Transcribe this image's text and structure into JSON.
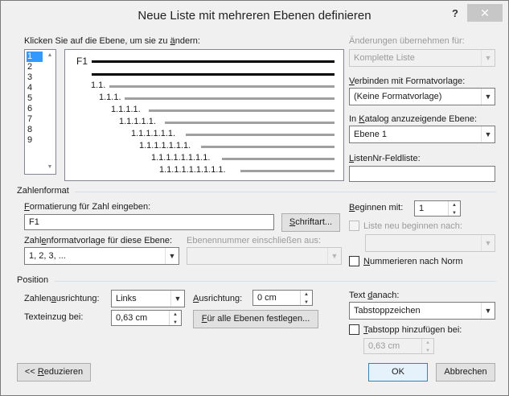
{
  "window": {
    "title": "Neue Liste mit mehreren Ebenen definieren",
    "help": "?",
    "close": "✕"
  },
  "level_select": {
    "label_pre": "Klicken Sie auf die Ebene, um sie zu ",
    "label_u": "ä",
    "label_post": "ndern:",
    "items": [
      "1",
      "2",
      "3",
      "4",
      "5",
      "6",
      "7",
      "8",
      "9"
    ],
    "selected": "1"
  },
  "preview": {
    "first": "F1",
    "levels": [
      "1.1.",
      "1.1.1.",
      "1.1.1.1.",
      "1.1.1.1.1.",
      "1.1.1.1.1.1.",
      "1.1.1.1.1.1.1.",
      "1.1.1.1.1.1.1.1.",
      "1.1.1.1.1.1.1.1.1."
    ]
  },
  "right_panel": {
    "apply_label": "Änderungen übernehmen für:",
    "apply_value": "Komplette Liste",
    "link_label_pre": "",
    "link_label_u": "V",
    "link_label_post": "erbinden mit Formatvorlage:",
    "link_value": "(Keine Formatvorlage)",
    "gallery_label_pre": "In ",
    "gallery_label_u": "K",
    "gallery_label_post": "atalog anzuzeigende Ebene:",
    "gallery_value": "Ebene 1",
    "listnum_label_pre": "",
    "listnum_label_u": "L",
    "listnum_label_post": "istenNr-Feldliste:",
    "listnum_value": ""
  },
  "number_format": {
    "group": "Zahlenformat",
    "format_label_pre": "",
    "format_label_u": "F",
    "format_label_post": "ormatierung für Zahl eingeben:",
    "format_value": "F1",
    "font_button_pre": "",
    "font_button_u": "S",
    "font_button_post": "chriftart...",
    "style_label_pre": "Zahl",
    "style_label_u": "e",
    "style_label_post": "nformatvorlage für diese Ebene:",
    "style_value": "1, 2, 3, ...",
    "include_label": "Ebenennummer einschließen aus:",
    "include_value": "",
    "start_label_pre": "",
    "start_label_u": "B",
    "start_label_post": "eginnen mit:",
    "start_value": "1",
    "restart_label": "Liste neu beginnen nach:",
    "restart_value": "",
    "legal_label_pre": "",
    "legal_label_u": "N",
    "legal_label_post": "ummerieren nach Norm"
  },
  "position": {
    "group": "Position",
    "align_label_pre": "Zahlen",
    "align_label_u": "a",
    "align_label_post": "usrichtung:",
    "align_value": "Links",
    "alignment_label_pre": "",
    "alignment_label_u": "A",
    "alignment_label_post": "usrichtung:",
    "alignment_value": "0 cm",
    "indent_label_pre": "Texteinzu",
    "indent_label_u": "g",
    "indent_label_post": " bei:",
    "indent_value": "0,63 cm",
    "set_all_pre": "",
    "set_all_u": "F",
    "set_all_post": "ür alle Ebenen festlegen...",
    "follow_label_pre": "Text ",
    "follow_label_u": "d",
    "follow_label_post": "anach:",
    "follow_value": "Tabstoppzeichen",
    "tabstop_label_pre": "",
    "tabstop_label_u": "T",
    "tabstop_label_post": "abstopp hinzufügen bei:",
    "tabstop_value": "0,63 cm"
  },
  "footer": {
    "reduce_pre": "<< ",
    "reduce_u": "R",
    "reduce_post": "eduzieren",
    "ok": "OK",
    "cancel": "Abbrechen"
  }
}
